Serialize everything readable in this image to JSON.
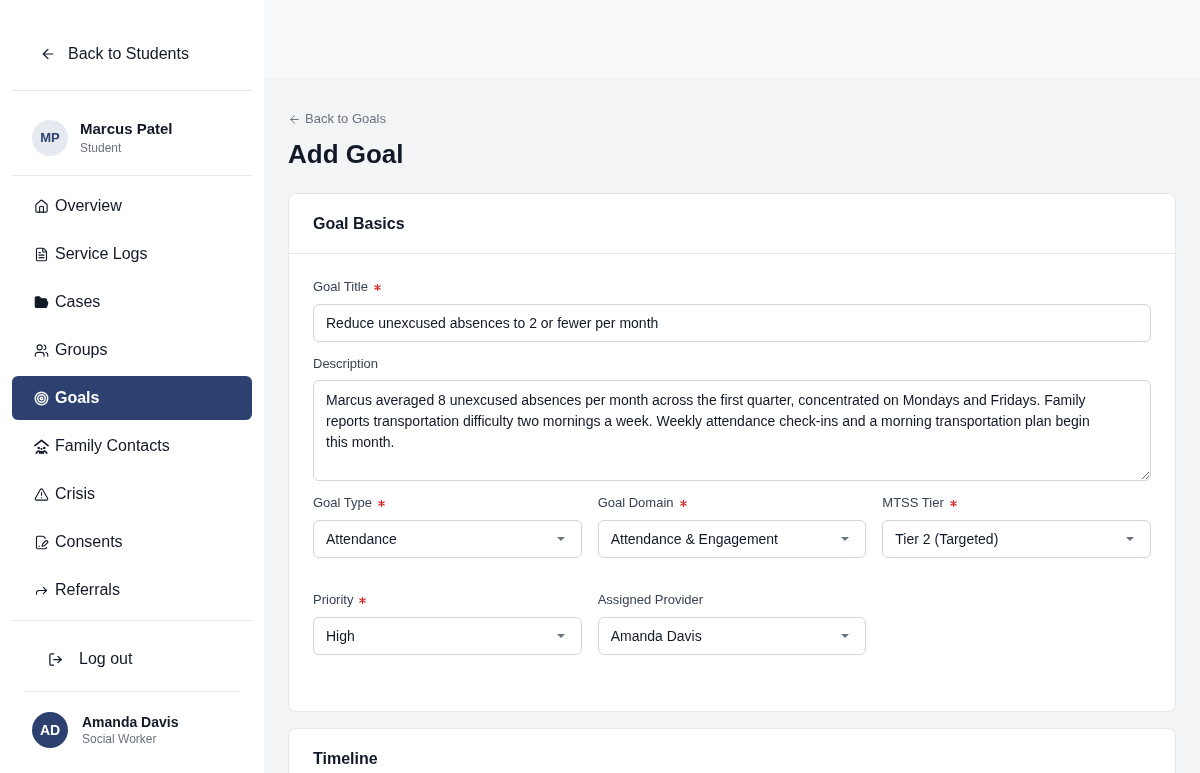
{
  "sidebar": {
    "back_link": "Back to Students",
    "student": {
      "initials": "MP",
      "name": "Marcus Patel",
      "role": "Student"
    },
    "nav_items": [
      {
        "label": "Overview",
        "selected": false
      },
      {
        "label": "Service Logs",
        "selected": false
      },
      {
        "label": "Cases",
        "selected": false
      },
      {
        "label": "Groups",
        "selected": false
      },
      {
        "label": "Goals",
        "selected": true
      },
      {
        "label": "Family Contacts",
        "selected": false
      },
      {
        "label": "Crisis",
        "selected": false
      },
      {
        "label": "Consents",
        "selected": false
      },
      {
        "label": "Referrals",
        "selected": false
      }
    ],
    "logout": "Log out",
    "user": {
      "initials": "AD",
      "name": "Amanda Davis",
      "role": "Social Worker"
    }
  },
  "main": {
    "back_link": "Back to Goals",
    "title": "Add Goal",
    "sections": [
      {
        "title": "Goal Basics",
        "fields": [
          {
            "kind": "text",
            "label": "Goal Title",
            "required": true,
            "value": "Reduce unexcused absences to 2 or fewer per month"
          },
          {
            "kind": "textarea",
            "label": "Description",
            "required": false,
            "value": "Marcus averaged 8 unexcused absences per month across the first quarter, concentrated on Mondays and Fridays. Family reports transportation difficulty two mornings a week. Weekly attendance check-ins and a morning transportation plan begin this month."
          },
          {
            "kind": "select",
            "label": "Goal Type",
            "required": true,
            "value": "Attendance"
          },
          {
            "kind": "select",
            "label": "Goal Domain",
            "required": true,
            "value": "Attendance & Engagement"
          },
          {
            "kind": "select",
            "label": "MTSS Tier",
            "required": true,
            "value": "Tier 2 (Targeted)"
          },
          {
            "kind": "select",
            "label": "Priority",
            "required": true,
            "value": "High"
          },
          {
            "kind": "select",
            "label": "Assigned Provider",
            "required": false,
            "value": "Amanda Davis"
          }
        ]
      },
      {
        "title": "Timeline"
      }
    ]
  }
}
